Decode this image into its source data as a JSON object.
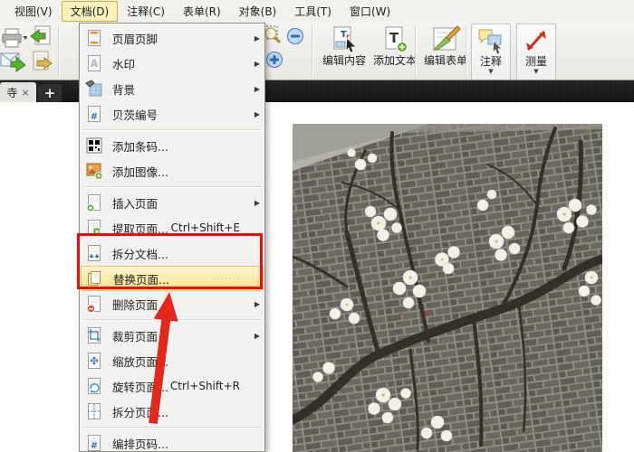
{
  "menubar": {
    "items": [
      {
        "label": "视图(V)",
        "active": false
      },
      {
        "label": "文档(D)",
        "active": true
      },
      {
        "label": "注释(C)",
        "active": false
      },
      {
        "label": "表单(R)",
        "active": false
      },
      {
        "label": "对象(B)",
        "active": false
      },
      {
        "label": "工具(T)",
        "active": false
      },
      {
        "label": "窗口(W)",
        "active": false
      }
    ]
  },
  "toolbar": {
    "left_icons": [
      "printer-icon",
      "import-doc-icon",
      "email-icon",
      "export-doc-icon"
    ],
    "zoom_icons": [
      "marquee-zoom-icon",
      "zoom-out-icon",
      "zoom-in-icon"
    ],
    "buttons": [
      {
        "icon": "edit-content-icon",
        "label": "编辑内容",
        "dropdown": false,
        "boxed": false
      },
      {
        "icon": "add-text-icon",
        "label": "添加文本",
        "dropdown": false,
        "boxed": false
      },
      {
        "icon": "edit-form-icon",
        "label": "编辑表单",
        "dropdown": false,
        "boxed": false,
        "sep_before": true
      },
      {
        "icon": "comment-icon",
        "label": "注释",
        "dropdown": true,
        "boxed": true,
        "sep_before": true
      },
      {
        "icon": "measure-icon",
        "label": "测量",
        "dropdown": true,
        "boxed": true
      }
    ]
  },
  "tabbar": {
    "active_tab": {
      "label": "寺",
      "close_glyph": "×"
    },
    "new_tab_label": "+"
  },
  "document_menu": {
    "items": [
      {
        "icon": "header-footer-icon",
        "label": "页眉页脚",
        "shortcut": "",
        "submenu": true,
        "sep_after": false,
        "highlighted": false
      },
      {
        "icon": "watermark-icon",
        "label": "水印",
        "shortcut": "",
        "submenu": true,
        "sep_after": false,
        "highlighted": false
      },
      {
        "icon": "background-icon",
        "label": "背景",
        "shortcut": "",
        "submenu": true,
        "sep_after": false,
        "highlighted": false
      },
      {
        "icon": "bates-number-icon",
        "label": "贝茨编号",
        "shortcut": "",
        "submenu": true,
        "sep_after": true,
        "highlighted": false
      },
      {
        "icon": "barcode-icon",
        "label": "添加条码...",
        "shortcut": "",
        "submenu": false,
        "sep_after": false,
        "highlighted": false
      },
      {
        "icon": "add-image-icon",
        "label": "添加图像...",
        "shortcut": "",
        "submenu": false,
        "sep_after": true,
        "highlighted": false
      },
      {
        "icon": "insert-pages-icon",
        "label": "插入页面",
        "shortcut": "",
        "submenu": true,
        "sep_after": false,
        "highlighted": false
      },
      {
        "icon": "extract-pages-icon",
        "label": "提取页面...",
        "shortcut": "Ctrl+Shift+E",
        "submenu": false,
        "sep_after": false,
        "highlighted": false
      },
      {
        "icon": "split-document-icon",
        "label": "拆分文档...",
        "shortcut": "",
        "submenu": false,
        "sep_after": false,
        "highlighted": false
      },
      {
        "icon": "replace-pages-icon",
        "label": "替换页面...",
        "shortcut": "",
        "submenu": false,
        "sep_after": false,
        "highlighted": true,
        "dots": "·······"
      },
      {
        "icon": "delete-pages-icon",
        "label": "删除页面",
        "shortcut": "",
        "submenu": true,
        "sep_after": true,
        "highlighted": false
      },
      {
        "icon": "crop-pages-icon",
        "label": "裁剪页面",
        "shortcut": "",
        "submenu": true,
        "sep_after": false,
        "highlighted": false
      },
      {
        "icon": "resize-pages-icon",
        "label": "缩放页面...",
        "shortcut": "",
        "submenu": false,
        "sep_after": false,
        "highlighted": false
      },
      {
        "icon": "rotate-pages-icon",
        "label": "旋转页面...",
        "shortcut": "Ctrl+Shift+R",
        "submenu": false,
        "sep_after": false,
        "highlighted": false
      },
      {
        "icon": "split-pages-icon",
        "label": "拆分页面...",
        "shortcut": "",
        "submenu": false,
        "sep_after": true,
        "highlighted": false
      },
      {
        "icon": "number-pages-icon",
        "label": "编排页码...",
        "shortcut": "",
        "submenu": false,
        "sep_after": false,
        "highlighted": false
      }
    ],
    "submenu_arrow_glyph": "▶"
  },
  "colors": {
    "annotation_red": "#ef0b0b",
    "menu_highlight_yellow": "#f6e288",
    "active_menu_bg": "#fcf1bc",
    "tabbar_dark": "#4a4a4a",
    "toolbar_bg": "#efeeea"
  }
}
